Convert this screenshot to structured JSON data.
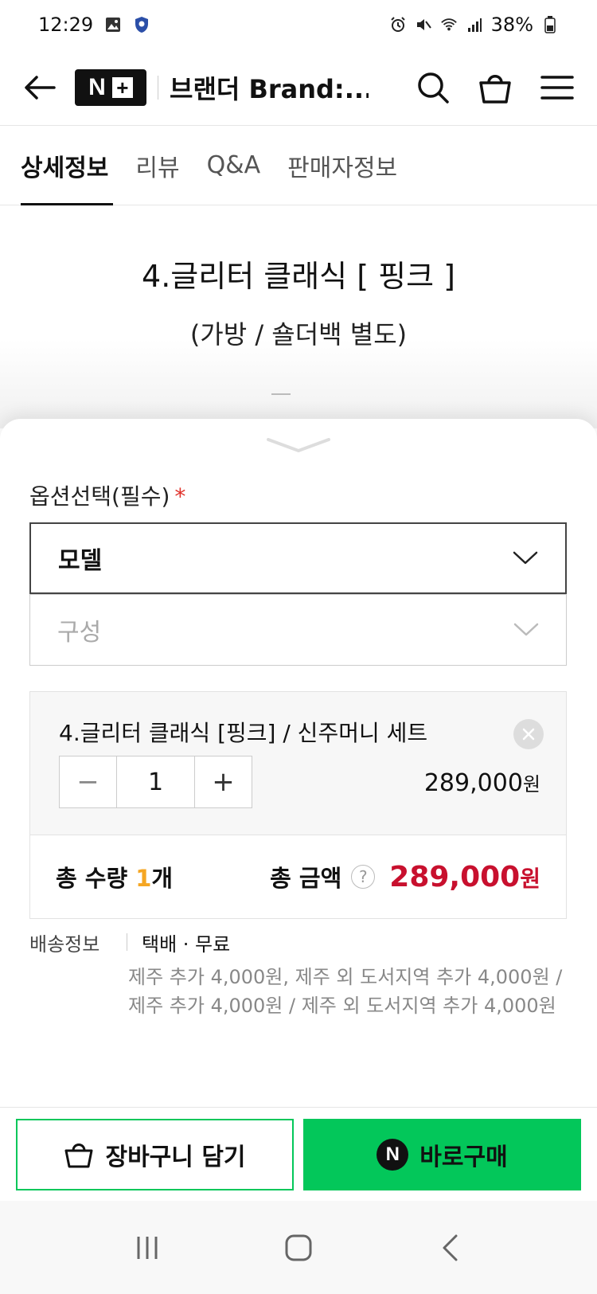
{
  "status_bar": {
    "time": "12:29",
    "battery": "38%"
  },
  "header": {
    "brand_mark": "N",
    "title": "브랜더 Brand:..."
  },
  "tabs": [
    {
      "label": "상세정보",
      "active": true
    },
    {
      "label": "리뷰",
      "active": false
    },
    {
      "label": "Q&A",
      "active": false
    },
    {
      "label": "판매자정보",
      "active": false
    }
  ],
  "description": {
    "title": "4.글리터 클래식 [ 핑크 ]",
    "subtitle": "(가방 / 숄더백 별도)"
  },
  "options": {
    "label": "옵션선택(필수)",
    "required_mark": "*",
    "select_model": "모델",
    "select_config": "구성"
  },
  "selected_item": {
    "name": "4.글리터 클래식 [핑크] / 신주머니 세트",
    "quantity": "1",
    "minus": "−",
    "plus": "+",
    "price": "289,000",
    "price_unit": "원"
  },
  "totals": {
    "qty_label": "총 수량 ",
    "qty_value": "1",
    "qty_unit": "개",
    "amount_label": "총 금액",
    "help": "?",
    "amount_value": "289,000",
    "amount_unit": "원"
  },
  "shipping": {
    "label": "배송정보",
    "main": "택배 · 무료",
    "detail": "제주 추가 4,000원, 제주 외 도서지역 추가 4,000원 / 제주 추가 4,000원 / 제주 외 도서지역 추가 4,000원"
  },
  "actions": {
    "cart": "장바구니 담기",
    "buy_badge": "N",
    "buy": "바로구매"
  },
  "colors": {
    "naver_green": "#03c75a",
    "price_red": "#c8102e",
    "qty_orange": "#f5a623"
  }
}
